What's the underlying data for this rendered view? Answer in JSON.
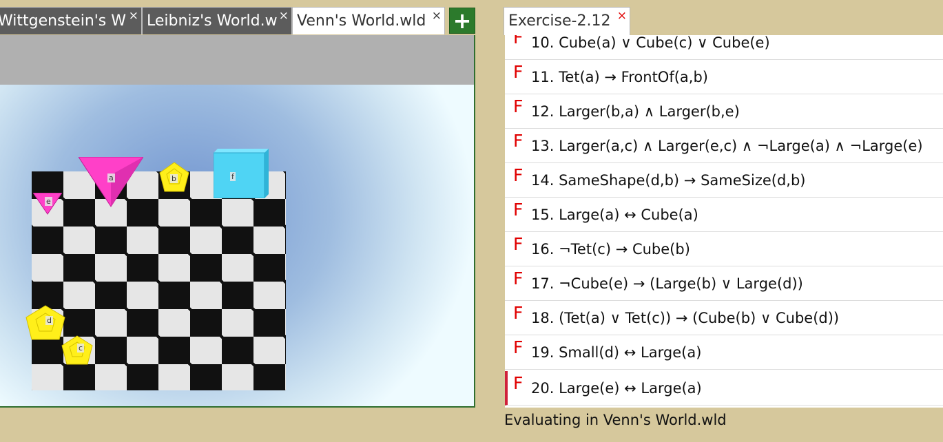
{
  "world_tabs": [
    {
      "label": "Wittgenstein's W",
      "close": "×"
    },
    {
      "label": "Leibniz's World.w",
      "close": "×"
    },
    {
      "label": "Venn's World.wld",
      "close": "×"
    }
  ],
  "add_tab_label": "+",
  "world": {
    "objects": [
      {
        "label": "a",
        "shape": "tetrahedron",
        "size": "large",
        "color": "#ff40c8"
      },
      {
        "label": "b",
        "shape": "dodecahedron",
        "size": "small",
        "color": "#ffef1a"
      },
      {
        "label": "c",
        "shape": "dodecahedron",
        "size": "small",
        "color": "#ffef1a"
      },
      {
        "label": "d",
        "shape": "dodecahedron",
        "size": "medium",
        "color": "#ffef1a"
      },
      {
        "label": "e",
        "shape": "tetrahedron",
        "size": "small",
        "color": "#ff40c8"
      },
      {
        "label": "f",
        "shape": "cube",
        "size": "large",
        "color": "#4fd4f4"
      }
    ]
  },
  "exercise_tab": {
    "label": "Exercise-2.12",
    "close": "×"
  },
  "sentences": [
    {
      "tv": "F",
      "text": "10. Cube(a) ∨ Cube(c) ∨ Cube(e)"
    },
    {
      "tv": "F",
      "text": "11. Tet(a) → FrontOf(a,b)"
    },
    {
      "tv": "F",
      "text": "12. Larger(b,a) ∧ Larger(b,e)"
    },
    {
      "tv": "F",
      "text": "13. Larger(a,c) ∧ Larger(e,c) ∧ ¬Large(a) ∧ ¬Large(e)"
    },
    {
      "tv": "F",
      "text": "14. SameShape(d,b) → SameSize(d,b)"
    },
    {
      "tv": "F",
      "text": "15. Large(a) ↔ Cube(a)"
    },
    {
      "tv": "F",
      "text": "16. ¬Tet(c) → Cube(b)"
    },
    {
      "tv": "F",
      "text": "17. ¬Cube(e) → (Large(b) ∨ Large(d))"
    },
    {
      "tv": "F",
      "text": "18. (Tet(a) ∨ Tet(c)) → (Cube(b) ∨ Cube(d))"
    },
    {
      "tv": "F",
      "text": "19. Small(d)  ↔  Large(a)"
    },
    {
      "tv": "F",
      "text": "20.  Large(e)  ↔  Large(a)"
    }
  ],
  "status": "Evaluating in Venn's World.wld"
}
